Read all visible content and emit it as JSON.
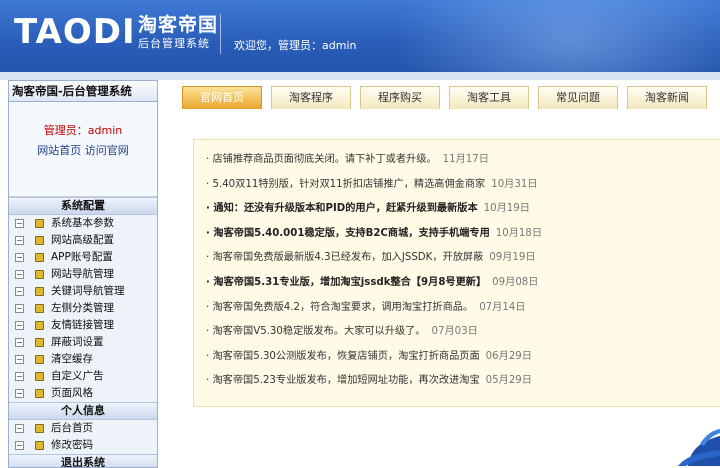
{
  "header": {
    "logo": "TAODI",
    "brand_cn": "淘客帝国",
    "subtitle": "后台管理系统",
    "welcome": "欢迎您，管理员：admin"
  },
  "sidebar": {
    "title": "淘客帝国-后台管理系统",
    "admin_label": "管理员：admin",
    "link_home": "网站首页",
    "link_official": "访问官网",
    "sections": [
      {
        "title": "系统配置",
        "items": [
          "系统基本参数",
          "网站高级配置",
          "APP账号配置",
          "网站导航管理",
          "关键词导航管理",
          "左侧分类管理",
          "友情链接管理",
          "屏蔽词设置",
          "清空缓存",
          "自定义广告",
          "页面风格"
        ]
      },
      {
        "title": "个人信息",
        "items": [
          "后台首页",
          "修改密码"
        ]
      },
      {
        "title": "退出系统",
        "items": [
          "退出系统"
        ]
      }
    ]
  },
  "tabs": [
    "官网首页",
    "淘客程序",
    "程序购买",
    "淘客工具",
    "常见问题",
    "淘客新闻"
  ],
  "active_tab": 0,
  "news": [
    {
      "text": "店铺推荐商品页面彻底关闭。请下补丁或者升级。",
      "date": "11月17日",
      "bold": false
    },
    {
      "text": "5.40双11特别版，针对双11折扣店铺推广，精选高佣金商家",
      "date": "10月31日",
      "bold": false
    },
    {
      "text": "通知：还没有升级版本和PID的用户，赶紧升级到最新版本",
      "date": "10月19日",
      "bold": true
    },
    {
      "text": "淘客帝国5.40.001稳定版，支持B2C商城，支持手机端专用",
      "date": "10月18日",
      "bold": true
    },
    {
      "text": "淘客帝国免费版最新版4.3已经发布，加入JSSDK，开放屏蔽",
      "date": "09月19日",
      "bold": false
    },
    {
      "text": " 淘客帝国5.31专业版，增加淘宝jssdk整合【9月8号更新】",
      "date": "09月08日",
      "bold": true
    },
    {
      "text": "淘客帝国免费版4.2，符合淘宝要求，调用淘宝打折商品。",
      "date": "07月14日",
      "bold": false
    },
    {
      "text": "淘客帝国V5.30稳定版发布。大家可以升级了。",
      "date": "07月03日",
      "bold": false
    },
    {
      "text": "淘客帝国5.30公测版发布，恢复店铺页，淘宝打折商品页面",
      "date": "06月29日",
      "bold": false
    },
    {
      "text": "淘客帝国5.23专业版发布，增加短网址功能，再次改进淘宝",
      "date": "05月29日",
      "bold": false
    }
  ],
  "colors": {
    "header": "#2b5fba",
    "admin": "#c00000",
    "tab_active": "#eaa42a",
    "panel": "#fffbe6"
  }
}
